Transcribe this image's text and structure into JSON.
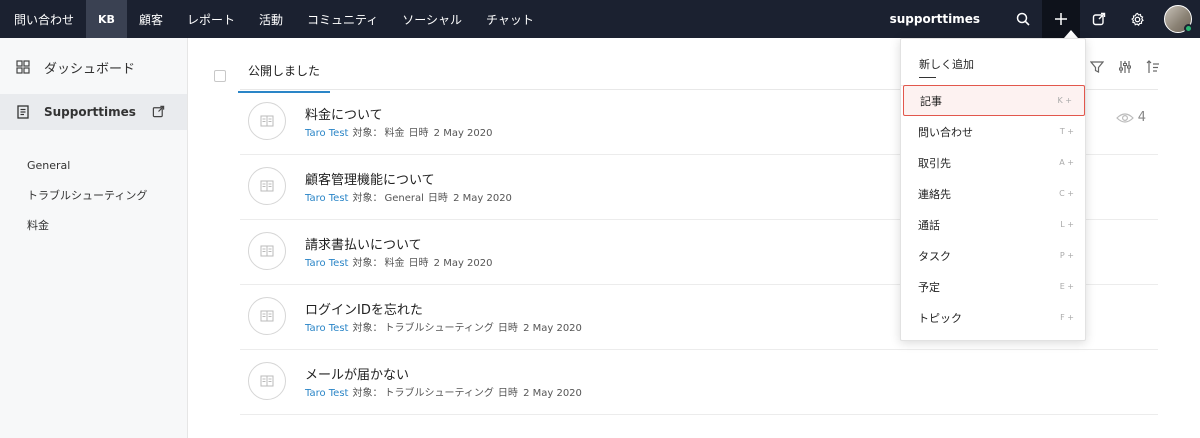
{
  "topbar": {
    "nav": [
      "問い合わせ",
      "KB",
      "顧客",
      "レポート",
      "活動",
      "コミュニティ",
      "ソーシャル",
      "チャット"
    ],
    "active_index": 1,
    "brand": "supporttimes"
  },
  "sidebar": {
    "dashboard_label": "ダッシュボード",
    "kb_label": "Supporttimes",
    "categories": [
      "General",
      "トラブルシューティング",
      "料金"
    ]
  },
  "main": {
    "tab_label": "公開しました",
    "meta_label": "対象：",
    "date_label": "日時",
    "articles": [
      {
        "title": "料金について",
        "author": "Taro Test",
        "category": "料金",
        "date": "2 May 2020",
        "views": "4"
      },
      {
        "title": "顧客管理機能について",
        "author": "Taro Test",
        "category": "General",
        "date": "2 May 2020"
      },
      {
        "title": "請求書払いについて",
        "author": "Taro Test",
        "category": "料金",
        "date": "2 May 2020"
      },
      {
        "title": "ログインIDを忘れた",
        "author": "Taro Test",
        "category": "トラブルシューティング",
        "date": "2 May 2020"
      },
      {
        "title": "メールが届かない",
        "author": "Taro Test",
        "category": "トラブルシューティング",
        "date": "2 May 2020"
      }
    ]
  },
  "dropdown": {
    "header": "新しく追加",
    "items": [
      {
        "label": "記事",
        "key": "K +"
      },
      {
        "label": "問い合わせ",
        "key": "T +"
      },
      {
        "label": "取引先",
        "key": "A +"
      },
      {
        "label": "連絡先",
        "key": "C +"
      },
      {
        "label": "通話",
        "key": "L +"
      },
      {
        "label": "タスク",
        "key": "P +"
      },
      {
        "label": "予定",
        "key": "E +"
      },
      {
        "label": "トピック",
        "key": "F +"
      }
    ],
    "highlight_color": "#e2574c"
  },
  "colors": {
    "topbar": "#1b2130",
    "accent": "#2a85c7"
  }
}
